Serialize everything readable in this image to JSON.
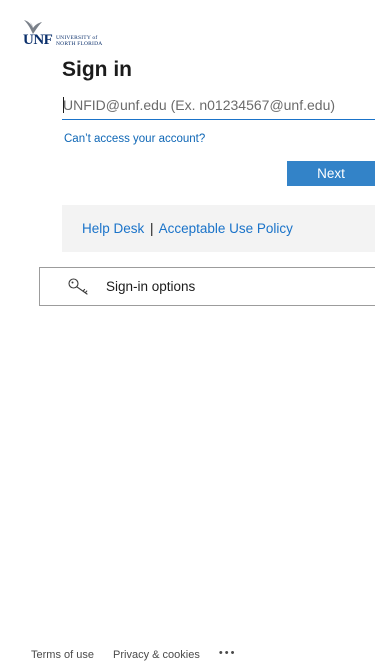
{
  "logo": {
    "icon": "osprey-logo-icon",
    "abbrev": "UNF",
    "line1": "UNIVERSITY of",
    "line2": "NORTH FLORIDA"
  },
  "title": "Sign in",
  "email": {
    "placeholder": "UNFID@unf.edu (Ex. n01234567@unf.edu)",
    "value": ""
  },
  "cant_access_link": "Can’t access your account?",
  "next_button": "Next",
  "help": {
    "help_desk": "Help Desk",
    "separator": "|",
    "acceptable_use": "Acceptable Use Policy"
  },
  "signin_options": {
    "icon": "key-icon",
    "label": "Sign-in options"
  },
  "footer": {
    "terms": "Terms of use",
    "privacy": "Privacy & cookies",
    "more": "•••"
  },
  "colors": {
    "accent": "#3383c8",
    "link": "#0f67b6",
    "panel": "#f3f3f3",
    "brand_navy": "#0a2f6b"
  }
}
